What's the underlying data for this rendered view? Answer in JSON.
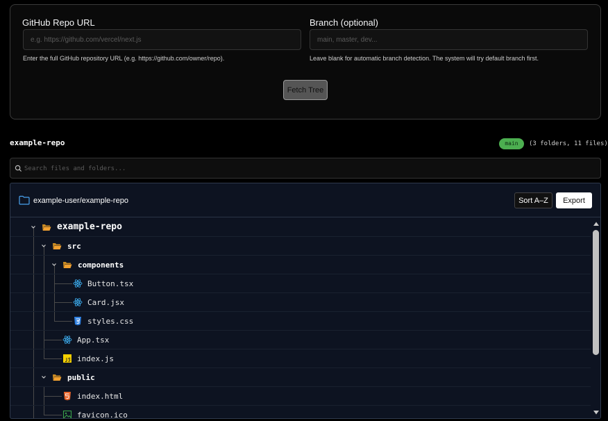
{
  "form": {
    "repo_label": "GitHub Repo URL",
    "repo_placeholder": "e.g. https://github.com/vercel/next.js",
    "repo_help": "Enter the full GitHub repository URL (e.g. https://github.com/owner/repo).",
    "branch_label": "Branch (optional)",
    "branch_placeholder": "main, master, dev...",
    "branch_help": "Leave blank for automatic branch detection. The system will try default branch first.",
    "fetch_label": "Fetch Tree"
  },
  "summary": {
    "repo_name": "example-repo",
    "branch": "main",
    "counts": "(3 folders, 11 files)"
  },
  "search": {
    "placeholder": "Search files and folders..."
  },
  "tree": {
    "header_title": "example-user/example-repo",
    "sort_label": "Sort A–Z",
    "export_label": "Export",
    "items": [
      {
        "name": "example-repo",
        "type": "folder",
        "icon": "folder-open-icon"
      },
      {
        "name": "src",
        "type": "folder",
        "icon": "folder-open-icon"
      },
      {
        "name": "components",
        "type": "folder",
        "icon": "folder-open-icon"
      },
      {
        "name": "Button.tsx",
        "type": "file",
        "icon": "react-icon"
      },
      {
        "name": "Card.jsx",
        "type": "file",
        "icon": "react-icon"
      },
      {
        "name": "styles.css",
        "type": "file",
        "icon": "css-icon"
      },
      {
        "name": "App.tsx",
        "type": "file",
        "icon": "react-icon"
      },
      {
        "name": "index.js",
        "type": "file",
        "icon": "js-icon"
      },
      {
        "name": "public",
        "type": "folder",
        "icon": "folder-open-icon"
      },
      {
        "name": "index.html",
        "type": "file",
        "icon": "html-icon"
      },
      {
        "name": "favicon.ico",
        "type": "file",
        "icon": "image-icon"
      }
    ]
  },
  "colors": {
    "accent_green": "#4caf50",
    "folder": "#f0a030",
    "react": "#3ba8e8",
    "css": "#2f7fe0",
    "js": "#f5d000",
    "html": "#e8642a",
    "image": "#3aa04a"
  }
}
